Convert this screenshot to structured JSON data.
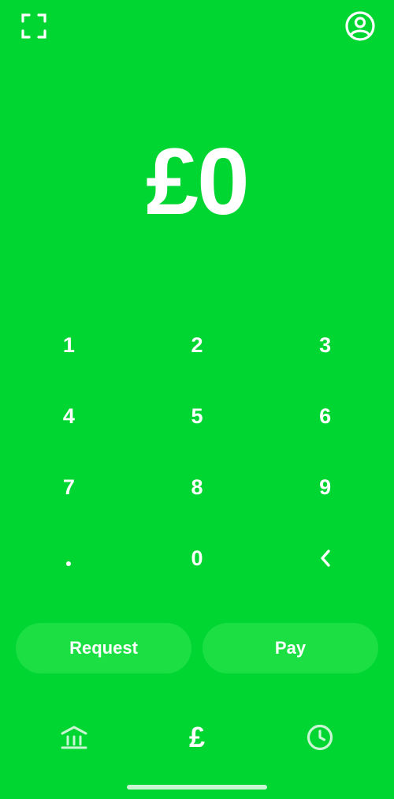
{
  "header": {
    "scan_icon": "scan-icon",
    "profile_icon": "profile-icon"
  },
  "amount": {
    "display": "£0"
  },
  "keypad": {
    "keys": [
      "1",
      "2",
      "3",
      "4",
      "5",
      "6",
      "7",
      "8",
      "9",
      ".",
      "0",
      "<"
    ]
  },
  "actions": {
    "request_label": "Request",
    "pay_label": "Pay"
  },
  "bottom_nav": {
    "items": [
      {
        "icon": "bank-icon"
      },
      {
        "icon": "pound-icon",
        "label": "£"
      },
      {
        "icon": "clock-icon"
      }
    ]
  },
  "colors": {
    "background": "#00D632",
    "button_fill": "#1CE043",
    "foreground": "#FFFFFF"
  }
}
